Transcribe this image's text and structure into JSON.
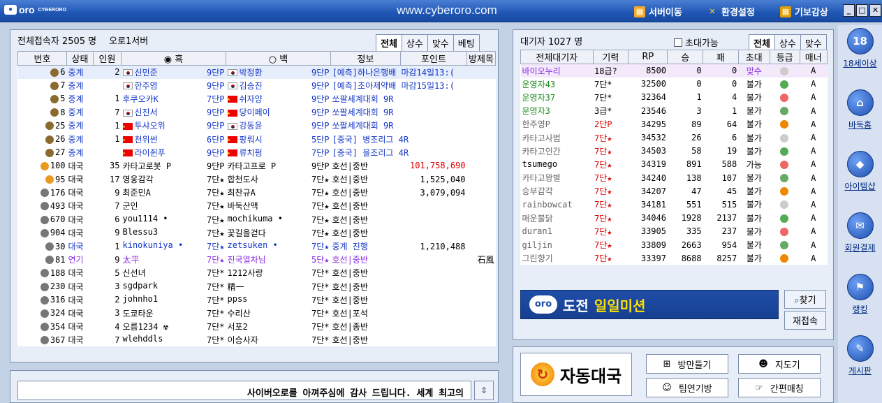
{
  "title": {
    "logo": "oro",
    "logo_sub": "CYBERORO",
    "url": "www.cyberoro.com",
    "btn1": "서버이동",
    "btn2": "환경설정",
    "btn3": "기보감상"
  },
  "left": {
    "connected": "전체접속자  2505 명",
    "server": "오로1서버",
    "tabs": [
      "전체",
      "상수",
      "맞수",
      "베팅"
    ],
    "headers": [
      "번호",
      "상태",
      "인원",
      "◉ 흑",
      "○ 백",
      "정보",
      "포인트",
      "방제목"
    ],
    "rows": [
      [
        "6",
        "중계",
        "2",
        "신민준",
        "9단P",
        "박정환",
        "9단P",
        "[예측]하나은행배 마감14일13:(",
        "",
        "blue",
        "k",
        "k"
      ],
      [
        "7",
        "중계",
        "",
        "한주영",
        "9단P",
        "김승진",
        "9단P",
        "[예측]조아제약배 마감15일13:(",
        "",
        "blue",
        "k",
        "k"
      ],
      [
        "5",
        "중계",
        "1",
        "후쿠오카K",
        "7단P",
        "쉬자양",
        "9단P",
        "쏘팔세계대회 9R",
        "",
        "blue",
        "",
        "c"
      ],
      [
        "8",
        "중계",
        "7",
        "신진서",
        "9단P",
        "당이페이",
        "9단P",
        "쏘팔세계대회 9R",
        "",
        "blue",
        "k",
        "c"
      ],
      [
        "25",
        "중계",
        "1",
        "투샤오위",
        "9단P",
        "강동윤",
        "9단P",
        "쏘팔세계대회 9R",
        "",
        "blue",
        "c",
        "k"
      ],
      [
        "26",
        "중계",
        "1",
        "천위썬",
        "6단P",
        "팡뤄시",
        "5단P",
        "[중국] 병조리그 4R",
        "",
        "blue",
        "c",
        "c"
      ],
      [
        "27",
        "중계",
        "",
        "라이쥔푸",
        "9단P",
        "류치펑",
        "7단P",
        "[중국] 을조리그 4R",
        "",
        "blue",
        "c",
        "c"
      ],
      [
        "100",
        "대국",
        "35",
        "카타고로봇 P",
        "9단P",
        "카타고프로 P",
        "9단P",
        "호선|중반",
        "101,758,690",
        "",
        "",
        " "
      ],
      [
        "95",
        "대국",
        "17",
        "영웅감각",
        "7단★",
        "합천도사",
        "7단★",
        "호선|중반",
        "1,525,040",
        "",
        "",
        ""
      ],
      [
        "176",
        "대국",
        "9",
        "최준민A",
        "7단★",
        "최찬규A",
        "7단★",
        "호선|중반",
        "3,079,094",
        "",
        "",
        ""
      ],
      [
        "493",
        "대국",
        "7",
        "군인",
        "7단★",
        "바둑산맥",
        "7단★",
        "호선|중반",
        "",
        "",
        "",
        ""
      ],
      [
        "670",
        "대국",
        "6",
        "you1114 •",
        "7단★",
        "mochikuma •",
        "7단★",
        "호선|중반",
        "",
        "",
        "",
        ""
      ],
      [
        "904",
        "대국",
        "9",
        "Blessu3",
        "7단★",
        "꿏길을걷다",
        "7단★",
        "호선|중반",
        "",
        "",
        "",
        ""
      ],
      [
        "30",
        "대국",
        "1",
        "kinokuniya •",
        "7단★",
        "zetsuken •",
        "7단★",
        "중계 진행",
        "1,210,488",
        "blue",
        "",
        ""
      ],
      [
        "81",
        "연기",
        "9",
        "太平",
        "7단★",
        "진국열차님",
        "5단★",
        "호선|중반",
        "",
        "purple",
        "",
        "",
        "石風"
      ],
      [
        "188",
        "대국",
        "5",
        "신선녀",
        "7단*",
        "1212사랑",
        "7단*",
        "호선|중반",
        "",
        "",
        "",
        ""
      ],
      [
        "230",
        "대국",
        "3",
        "sgdpark",
        "7단*",
        "精一",
        "7단*",
        "호선|중반",
        "",
        "",
        "",
        ""
      ],
      [
        "316",
        "대국",
        "2",
        "johnho1",
        "7단*",
        "ppss",
        "7단*",
        "호선|중반",
        "",
        "",
        "",
        ""
      ],
      [
        "324",
        "대국",
        "3",
        "도쿄타운",
        "7단*",
        "수리산",
        "7단*",
        "호선|포석",
        "",
        "",
        "",
        ""
      ],
      [
        "354",
        "대국",
        "4",
        "오름1234 ☢",
        "7단*",
        "서포2",
        "7단*",
        "호선|종반",
        "",
        "",
        "",
        ""
      ],
      [
        "367",
        "대국",
        "7",
        "wlehddls",
        "7단*",
        "이승사자",
        "7단*",
        "호선|중반",
        "",
        "",
        "",
        ""
      ]
    ]
  },
  "ticker": "사이버오로를 아껴주심에 감사 드립니다.  세계 최고의",
  "right": {
    "waiting": "대기자    1027 명",
    "checkbox": "초대가능",
    "tabs": [
      "전체",
      "상수",
      "맞수"
    ],
    "headers": [
      "전체대기자",
      "기력",
      "RP",
      "승",
      "패",
      "초대",
      "등급",
      "매너"
    ],
    "rows": [
      [
        "바이오누리",
        "18급?",
        "8500",
        "0",
        "0",
        "맞수",
        "A",
        "purple"
      ],
      [
        "운영자43",
        "7단*",
        "32500",
        "0",
        "0",
        "불가",
        "A",
        "green"
      ],
      [
        "운영자37",
        "7단*",
        "32364",
        "1",
        "4",
        "불가",
        "A",
        "green"
      ],
      [
        "운영자3",
        "3급*",
        "23546",
        "3",
        "1",
        "불가",
        "A",
        "green"
      ],
      [
        "한주영P",
        "2단P",
        "34295",
        "89",
        "64",
        "불가",
        "A",
        "gray"
      ],
      [
        "카타고사범",
        "7단★",
        "34532",
        "26",
        "6",
        "불가",
        "A",
        "gray"
      ],
      [
        "카타고인간",
        "7단★",
        "34503",
        "58",
        "19",
        "불가",
        "A",
        "gray"
      ],
      [
        "tsumego",
        "7단★",
        "34319",
        "891",
        "588",
        "가능",
        "A",
        ""
      ],
      [
        "카타고왕별",
        "7단★",
        "34240",
        "138",
        "107",
        "불가",
        "A",
        "gray"
      ],
      [
        "승부감각",
        "7단★",
        "34207",
        "47",
        "45",
        "불가",
        "A",
        "gray"
      ],
      [
        "rainbowcat",
        "7단★",
        "34181",
        "551",
        "515",
        "불가",
        "A",
        "gray"
      ],
      [
        "매운불닭",
        "7단★",
        "34046",
        "1928",
        "2137",
        "불가",
        "A",
        "gray"
      ],
      [
        "duran1",
        "7단★",
        "33905",
        "335",
        "237",
        "불가",
        "A",
        "gray"
      ],
      [
        "giljin",
        "7단★",
        "33809",
        "2663",
        "954",
        "불가",
        "A",
        "gray"
      ],
      [
        "그린향기",
        "7단★",
        "33397",
        "8688",
        "8257",
        "불가",
        "A",
        "gray"
      ]
    ],
    "mission_a": "도전 ",
    "mission_b": "일일미션",
    "find": "찾기",
    "reconnect": "재접속"
  },
  "auto": {
    "label": "자동대국",
    "b1": "방만들기",
    "b2": "지도기",
    "b3": "팀연기방",
    "b4": "간편매칭"
  },
  "side": [
    "18세이상",
    "바둑홈",
    "아이템샵",
    "회원결제",
    "랭킹",
    "게시판"
  ],
  "colors": {
    "accent": "#1f56b4",
    "live": "#1436c8",
    "point": "#d00"
  }
}
